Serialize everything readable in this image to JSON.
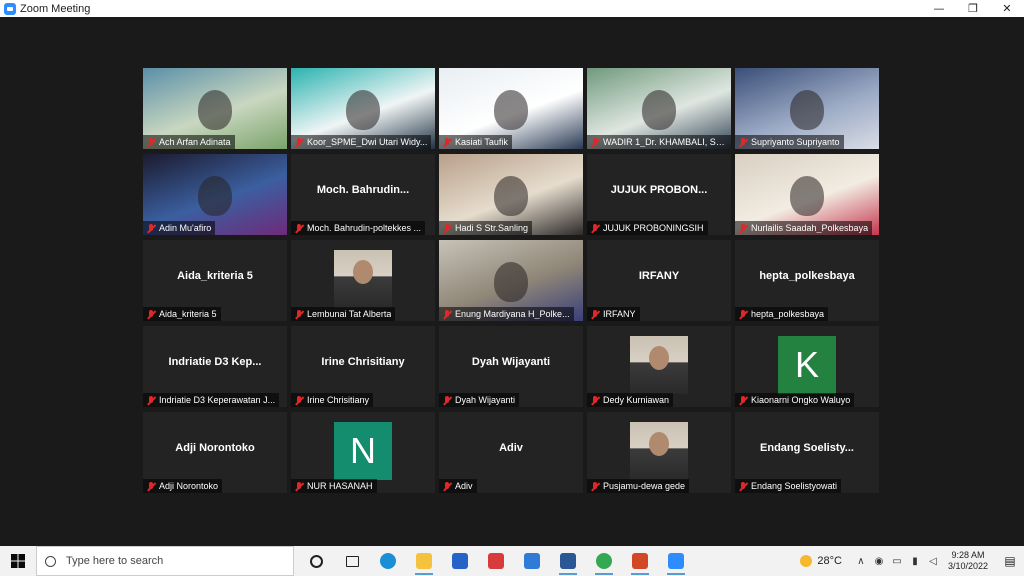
{
  "window": {
    "title": "Zoom Meeting",
    "minimize": "—",
    "restore": "❐",
    "close": "✕"
  },
  "accent": "#c4e536",
  "participants": [
    {
      "name": "Ach Arfan Adinata",
      "video": true
    },
    {
      "name": "Koor_SPME_Dwi Utari Widy...",
      "video": true
    },
    {
      "name": "Kasiati Taufik",
      "video": true
    },
    {
      "name": "WADIR 1_Dr. KHAMBALI, ST., ...",
      "video": true,
      "active": true
    },
    {
      "name": "Supriyanto Supriyanto",
      "video": true
    },
    {
      "name": "Adin Mu'afiro",
      "video": true
    },
    {
      "name": "Moch. Bahrudin-poltekkes ...",
      "display": "Moch. Bahrudin...",
      "video": false
    },
    {
      "name": "Hadi S Str.Sanling",
      "video": true
    },
    {
      "name": "JUJUK PROBONINGSIH",
      "display": "JUJUK PROBON...",
      "video": false
    },
    {
      "name": "Nurlailis Saadah_Polkesbaya",
      "video": true
    },
    {
      "name": "Aida_kriteria 5",
      "display": "Aida_kriteria 5",
      "video": false
    },
    {
      "name": "Lembunai Tat Alberta",
      "video": false,
      "photo": true
    },
    {
      "name": "Enung Mardiyana H_Polke...",
      "video": true
    },
    {
      "name": "IRFANY",
      "display": "IRFANY",
      "video": false
    },
    {
      "name": "hepta_polkesbaya",
      "display": "hepta_polkesbaya",
      "video": false
    },
    {
      "name": "Indriatie D3 Keperawatan J...",
      "display": "Indriatie D3 Kep...",
      "video": false
    },
    {
      "name": "Irine Chrisitiany",
      "display": "Irine Chrisitiany",
      "video": false
    },
    {
      "name": "Dyah Wijayanti",
      "display": "Dyah Wijayanti",
      "video": false
    },
    {
      "name": "Dedy Kurniawan",
      "video": false,
      "photo": true
    },
    {
      "name": "Kiaonarni Ongko Waluyo",
      "video": false,
      "letter": "K"
    },
    {
      "name": "Adji Norontoko",
      "display": "Adji Norontoko",
      "video": false
    },
    {
      "name": "NUR HASANAH",
      "video": false,
      "letter": "N"
    },
    {
      "name": "Adiv",
      "display": "Adiv",
      "video": false
    },
    {
      "name": "Pusjamu-dewa gede",
      "video": false,
      "photo": true
    },
    {
      "name": "Endang Soelistyowati",
      "display": "Endang  Soelisty...",
      "video": false
    }
  ],
  "taskbar": {
    "search_placeholder": "Type here to search",
    "temperature": "28°C",
    "time": "9:28 AM",
    "date": "3/10/2022",
    "apps": [
      "cortana-icon",
      "task-view-icon",
      "edge-icon",
      "file-explorer-icon",
      "store-icon",
      "gift-icon",
      "mail-icon",
      "word-icon",
      "chrome-icon",
      "powerpoint-icon",
      "zoom-icon"
    ]
  }
}
